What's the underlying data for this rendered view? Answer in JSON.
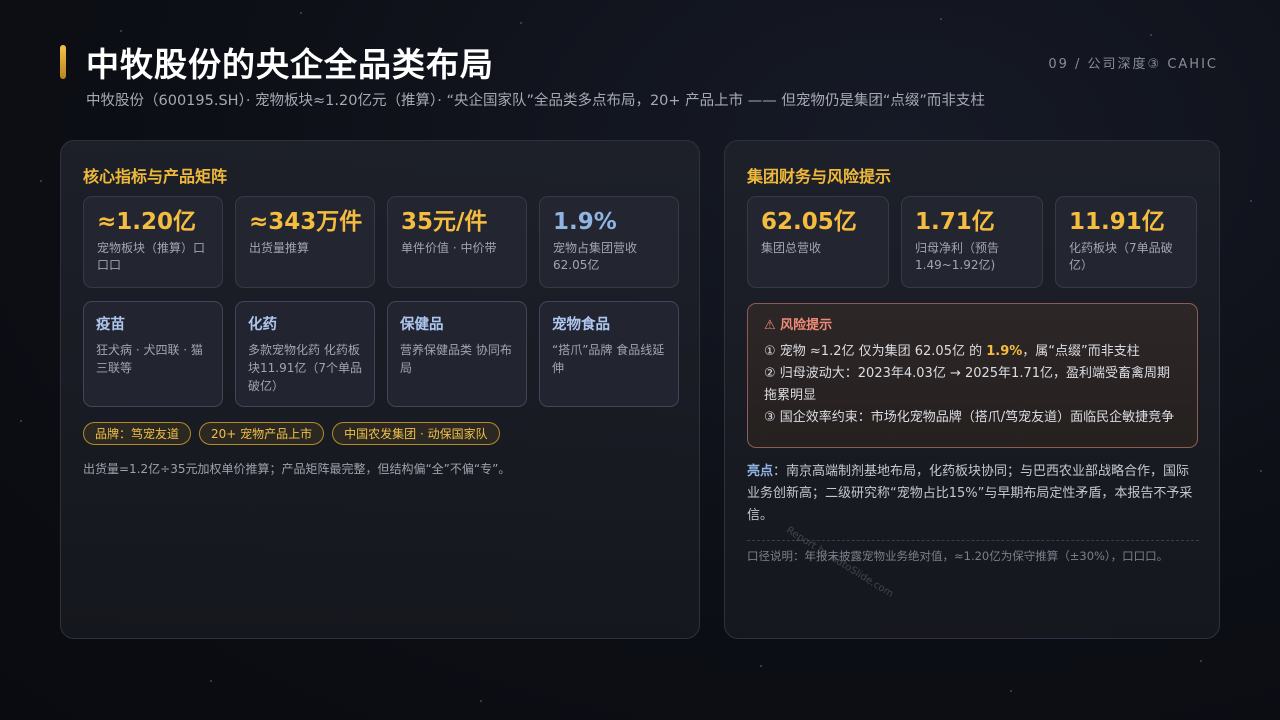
{
  "header": {
    "title": "中牧股份的央企全品类布局",
    "page_index": "09 / 公司深度③ CAHIC",
    "subtitle": "中牧股份（600195.SH）· 宠物板块≈1.20亿元（推算）· “央企国家队”全品类多点布局，20+ 产品上市 —— 但宠物仍是集团“点缀”而非支柱"
  },
  "left_panel": {
    "heading": "核心指标与产品矩阵",
    "metrics": [
      {
        "value": "≈1.20亿",
        "label": "宠物板块（推算）口口口"
      },
      {
        "value": "≈343万件",
        "label": "出货量推算"
      },
      {
        "value": "35元/件",
        "label": "单件价值 · 中价带"
      },
      {
        "value": "1.9%",
        "label": "宠物占集团营收 62.05亿"
      }
    ],
    "products": [
      {
        "name": "疫苗",
        "desc": "狂犬病 · 犬四联 · 猫三联等"
      },
      {
        "name": "化药",
        "desc": "多款宠物化药 化药板块11.91亿（7个单品破亿）"
      },
      {
        "name": "保健品",
        "desc": "营养保健品类 协同布局"
      },
      {
        "name": "宠物食品",
        "desc": "“搭爪”品牌 食品线延伸"
      }
    ],
    "tags": [
      "品牌：笃宠友道",
      "20+ 宠物产品上市",
      "中国农发集团 · 动保国家队"
    ],
    "footnote": "出货量=1.2亿÷35元加权单价推算；产品矩阵最完整，但结构偏“全”不偏“专”。"
  },
  "right_panel": {
    "heading": "集团财务与风险提示",
    "metrics": [
      {
        "value": "62.05亿",
        "label": "集团总营收"
      },
      {
        "value": "1.71亿",
        "label": "归母净利（预告 1.49~1.92亿)"
      },
      {
        "value": "11.91亿",
        "label": "化药板块（7单品破亿）"
      }
    ],
    "risk": {
      "head": "⚠ 风险提示",
      "line1_pre": "① 宠物 ≈1.2亿 仅为集团 62.05亿 的 ",
      "line1_hl": "1.9%",
      "line1_post": "，属“点缀”而非支柱",
      "line2": "② 归母波动大：2023年4.03亿 → 2025年1.71亿，盈利端受畜禽周期拖累明显",
      "line3": "③ 国企效率约束：市场化宠物品牌（搭爪/笃宠友道）面临民企敏捷竞争"
    },
    "highlight_label": "亮点",
    "highlight_text": "：南京高端制剂基地布局，化药板块协同；与巴西农业部战略合作，国际业务创新高；二级研究称“宠物占比15%”与早期布局定性矛盾，本报告不予采信。",
    "footnote": "口径说明：年报未披露宠物业务绝对值，≈1.20亿为保守推算（±30%），口口口。"
  },
  "watermark": "Report by AutoSlide.com"
}
